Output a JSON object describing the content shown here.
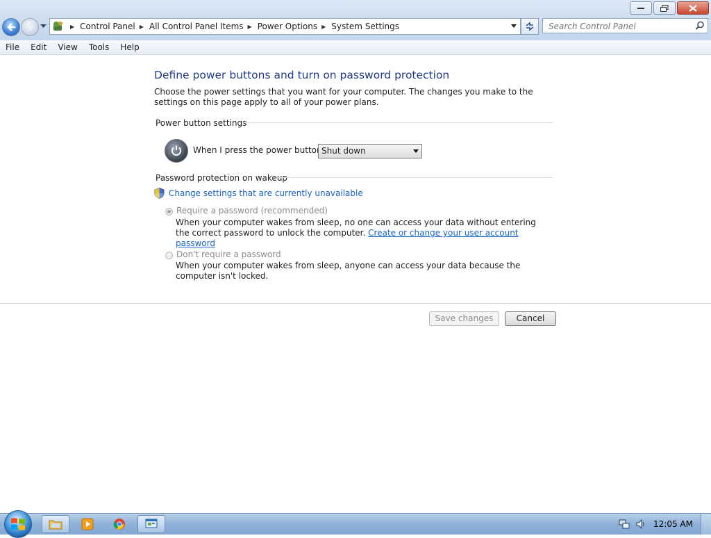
{
  "window": {
    "controls": [
      "minimize",
      "maximize",
      "close"
    ]
  },
  "address_bar": {
    "breadcrumbs": [
      "Control Panel",
      "All Control Panel Items",
      "Power Options",
      "System Settings"
    ]
  },
  "search": {
    "placeholder": "Search Control Panel"
  },
  "menu": {
    "items": [
      "File",
      "Edit",
      "View",
      "Tools",
      "Help"
    ]
  },
  "page": {
    "title": "Define power buttons and turn on password protection",
    "intro": "Choose the power settings that you want for your computer. The changes you make to the settings on this page apply to all of your power plans.",
    "power_section": {
      "title": "Power button settings",
      "label": "When I press the power button:",
      "selected": "Shut down"
    },
    "password_section": {
      "title": "Password protection on wakeup",
      "change_link": "Change settings that are currently unavailable",
      "options": [
        {
          "title": "Require a password (recommended)",
          "checked": true,
          "description": "When your computer wakes from sleep, no one can access your data without entering the correct password to unlock the computer.",
          "link": "Create or change your user account password"
        },
        {
          "title": "Don't require a password",
          "checked": false,
          "description": "When your computer wakes from sleep, anyone can access your data because the computer isn't locked."
        }
      ]
    },
    "buttons": {
      "save": "Save changes",
      "cancel": "Cancel"
    }
  },
  "taskbar": {
    "apps": [
      "explorer",
      "media-player",
      "chrome",
      "control-panel"
    ],
    "clock": "12:05 AM"
  }
}
